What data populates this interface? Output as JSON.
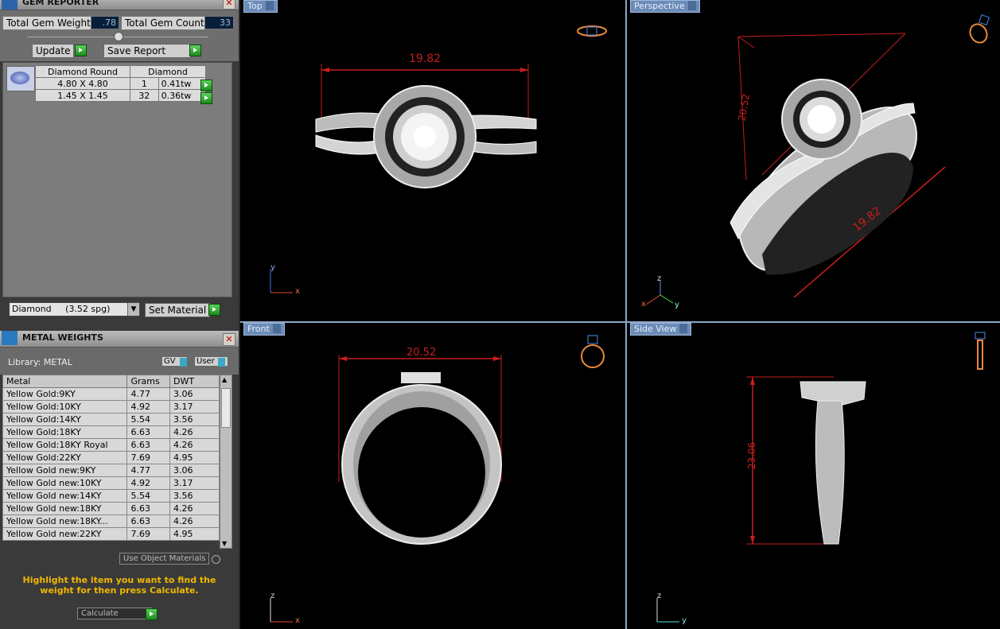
{
  "gem_reporter": {
    "title": "GEM REPORTER",
    "total_weight_label": "Total Gem Weight",
    "total_weight_value": ".78",
    "total_count_label": "Total Gem Count",
    "total_count_value": "33",
    "update_label": "Update",
    "save_report_label": "Save Report",
    "header": [
      "Diamond Round",
      "Diamond"
    ],
    "rows": [
      {
        "size": "4.80 X 4.80",
        "count": "1",
        "weight": "0.41tw"
      },
      {
        "size": "1.45 X 1.45",
        "count": "32",
        "weight": "0.36tw"
      }
    ],
    "material_select": "Diamond     (3.52 spg)",
    "set_material_label": "Set Material"
  },
  "metal_weights": {
    "title": "METAL WEIGHTS",
    "library_label": "Library: METAL",
    "gv_label": "GV",
    "user_label": "User",
    "columns": [
      "Metal",
      "Grams",
      "DWT"
    ],
    "rows": [
      [
        "Yellow Gold:9KY",
        "4.77",
        "3.06"
      ],
      [
        "Yellow Gold:10KY",
        "4.92",
        "3.17"
      ],
      [
        "Yellow Gold:14KY",
        "5.54",
        "3.56"
      ],
      [
        "Yellow Gold:18KY",
        "6.63",
        "4.26"
      ],
      [
        "Yellow Gold:18KY Royal",
        "6.63",
        "4.26"
      ],
      [
        "Yellow Gold:22KY",
        "7.69",
        "4.95"
      ],
      [
        "Yellow Gold new:9KY",
        "4.77",
        "3.06"
      ],
      [
        "Yellow Gold new:10KY",
        "4.92",
        "3.17"
      ],
      [
        "Yellow Gold new:14KY",
        "5.54",
        "3.56"
      ],
      [
        "Yellow Gold new:18KY",
        "6.63",
        "4.26"
      ],
      [
        "Yellow Gold new:18KY...",
        "6.63",
        "4.26"
      ],
      [
        "Yellow Gold new:22KY",
        "7.69",
        "4.95"
      ]
    ],
    "use_object_materials_label": "Use Object Materials",
    "hint": "Highlight the item you want to find the weight for then press Calculate.",
    "calculate_label": "Calculate"
  },
  "viewports": {
    "top": {
      "label": "Top",
      "dimension": "19.82",
      "axis1": "y",
      "axis2": "x"
    },
    "perspective": {
      "label": "Perspective",
      "dimension_a": "19.82",
      "dimension_b": "20.52",
      "axis1": "z",
      "axis2": "x",
      "axis3": "y"
    },
    "front": {
      "label": "Front",
      "dimension": "20.52",
      "axis1": "z",
      "axis2": "x"
    },
    "side": {
      "label": "Side View",
      "dimension": "23.06",
      "axis1": "z",
      "axis2": "y"
    }
  },
  "colors": {
    "dimension_red": "#c81e1e",
    "viewport_label_blue": "#6b8cb8",
    "hint_yellow": "#f0b800"
  }
}
